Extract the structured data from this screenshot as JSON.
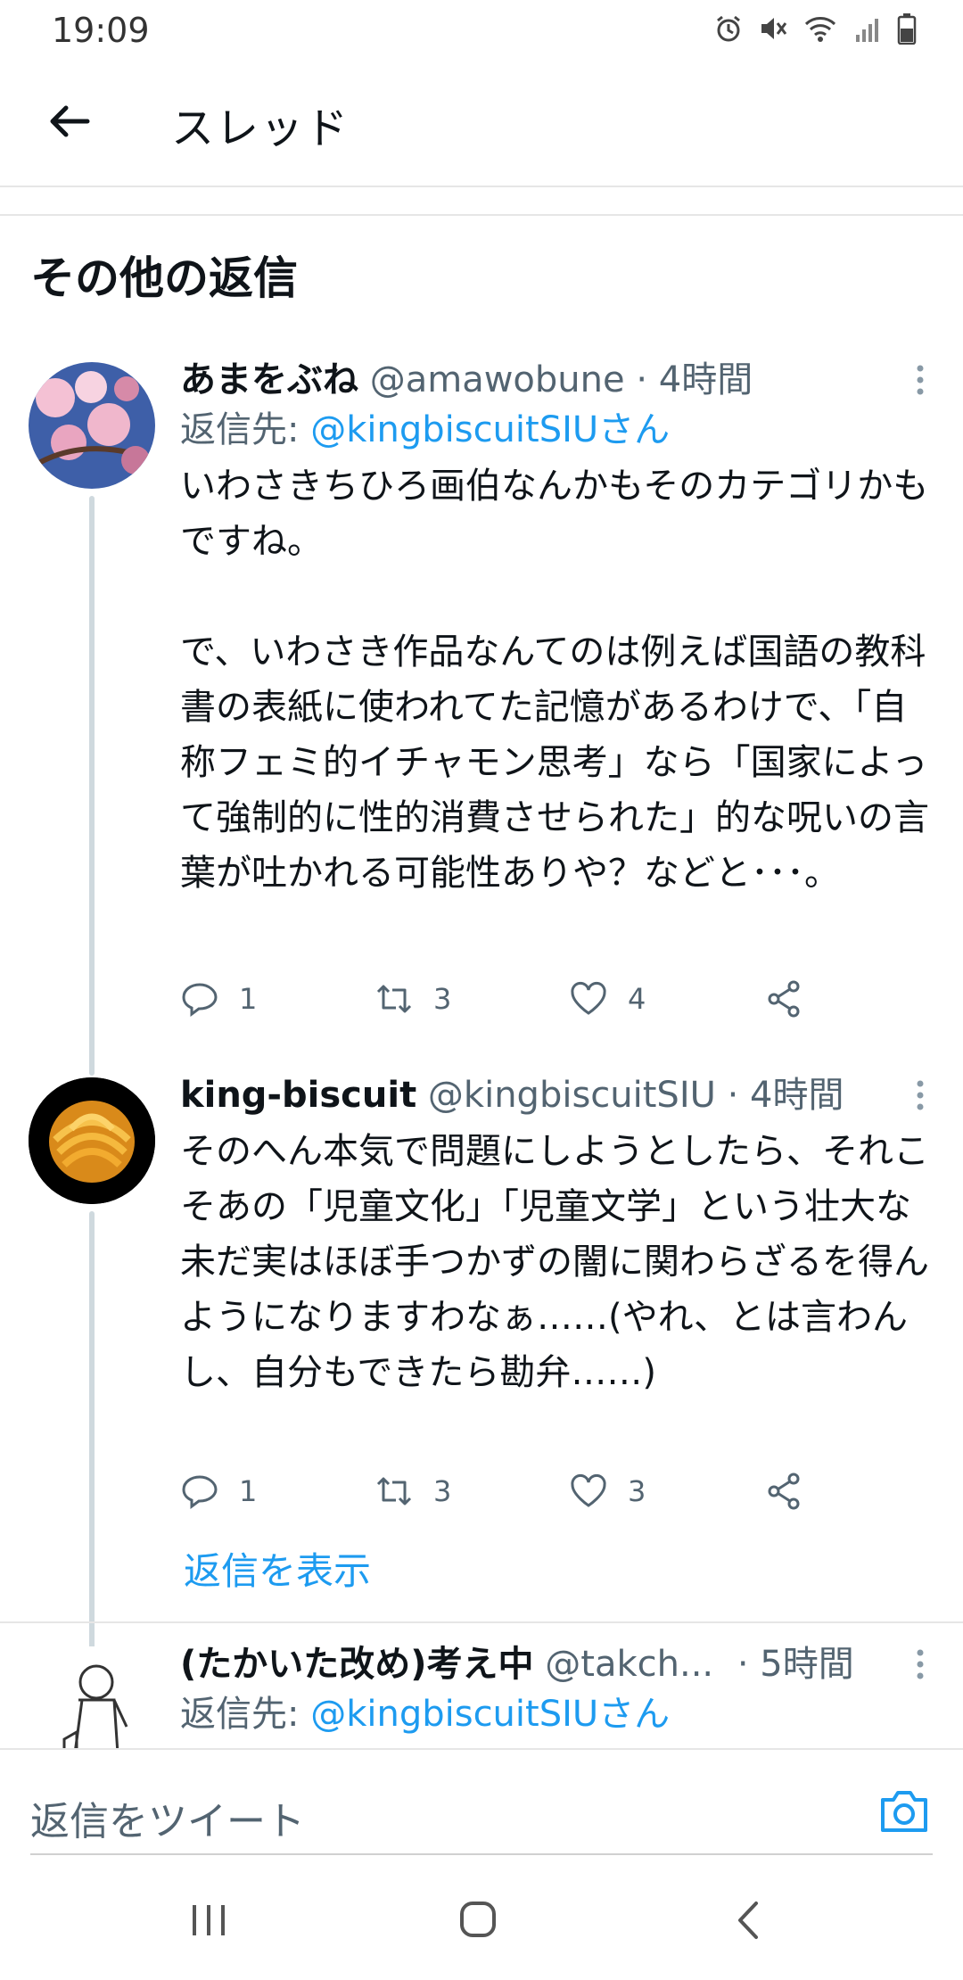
{
  "status_bar": {
    "time": "19:09"
  },
  "app_bar": {
    "title": "スレッド"
  },
  "section": {
    "title": "その他の返信"
  },
  "tweets": [
    {
      "name": "あまをぶね",
      "handle": "@amawobune · 4時間",
      "reply_prefix": "返信先: ",
      "reply_to": "@kingbiscuitSIUさん",
      "text": "いわさきちひろ画伯なんかもそのカテゴリかもですね。\n\nで、いわさき作品なんてのは例えば国語の教科書の表紙に使われてた記憶があるわけで、「自称フェミ的イチャモン思考」なら「国家によって強制的に性的消費させられた」的な呪いの言葉が吐かれる可能性ありや？などと･･･。",
      "replies": "1",
      "retweets": "3",
      "likes": "4"
    },
    {
      "name": "king-biscuit",
      "handle": "@kingbiscuitSIU · 4時間",
      "text": "そのへん本気で問題にしようとしたら、それこそあの「児童文化」「児童文学」という壮大な未だ実はほぼ手つかずの闇に関わらざるを得んようになりますわなぁ……(やれ、とは言わんし、自分もできたら勘弁……)",
      "replies": "1",
      "retweets": "3",
      "likes": "3"
    },
    {
      "name": "(たかいた改め)考え中",
      "handle": "@takch...",
      "time": "· 5時間",
      "reply_prefix": "返信先: ",
      "reply_to": "@kingbiscuitSIUさん"
    }
  ],
  "show_replies": "返信を表示",
  "composer": {
    "placeholder": "返信をツイート"
  },
  "colors": {
    "accent": "#1d9bf0",
    "muted": "#536471",
    "line": "#cfd9de"
  }
}
